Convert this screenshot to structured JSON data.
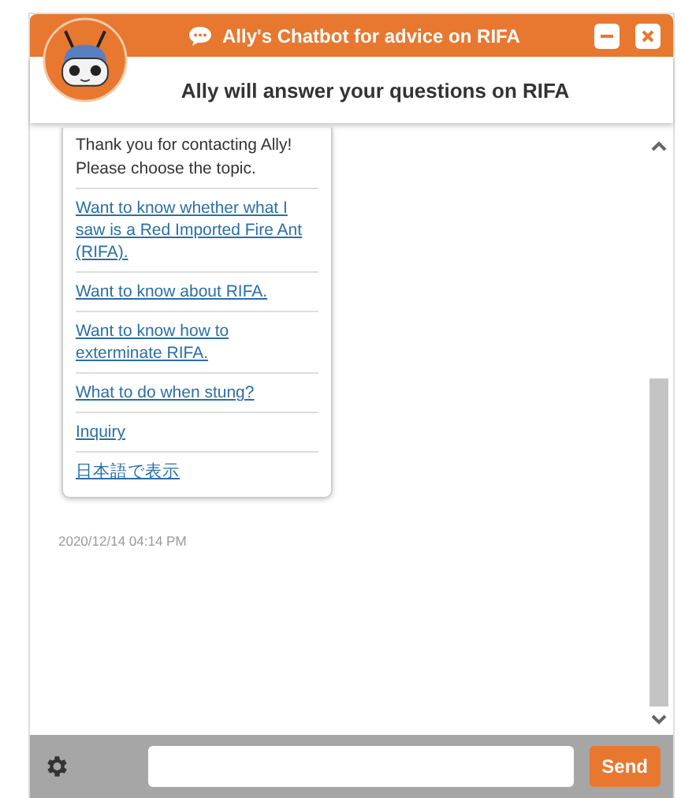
{
  "header": {
    "title": "Ally's Chatbot for advice on RIFA",
    "subtitle": "Ally will answer your questions on RIFA"
  },
  "message": {
    "text": [
      "Thank you for contacting Ally!",
      "Please choose the topic."
    ],
    "options": [
      {
        "label": "Want to know whether what I saw is a Red Imported Fire Ant (RIFA)."
      },
      {
        "label": "Want to know about RIFA."
      },
      {
        "label": "Want to know how to exterminate RIFA."
      },
      {
        "label": "What to do when stung?"
      },
      {
        "label": "Inquiry"
      },
      {
        "label": "日本語で表示"
      }
    ],
    "timestamp": "2020/12/14 04:14 PM"
  },
  "footer": {
    "send": "Send"
  }
}
